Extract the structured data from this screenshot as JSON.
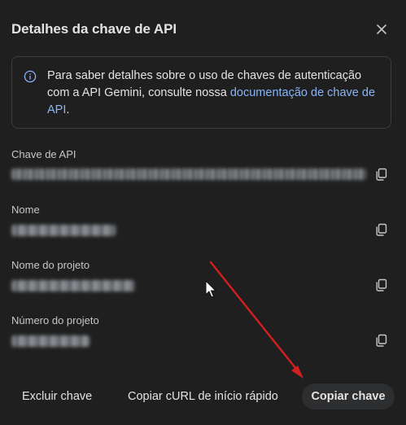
{
  "dialog": {
    "title": "Detalhes da chave de API",
    "close_icon": "close-icon"
  },
  "info": {
    "icon": "info-icon",
    "text": "Para saber detalhes sobre o uso de chaves de autenticação com a API Gemini, consulte nossa ",
    "link_text": "documentação de chave de API",
    "suffix": "."
  },
  "fields": [
    {
      "label": "Chave de API",
      "copy_icon": "copy-icon"
    },
    {
      "label": "Nome",
      "copy_icon": "copy-icon"
    },
    {
      "label": "Nome do projeto",
      "copy_icon": "copy-icon"
    },
    {
      "label": "Número do projeto",
      "copy_icon": "copy-icon"
    }
  ],
  "footer": {
    "delete_label": "Excluir chave",
    "curl_label": "Copiar cURL de início rápido",
    "copy_label": "Copiar chave"
  },
  "colors": {
    "background": "#1f1f1f",
    "link": "#8ab4f8",
    "annotation_arrow": "#d21f1f"
  }
}
